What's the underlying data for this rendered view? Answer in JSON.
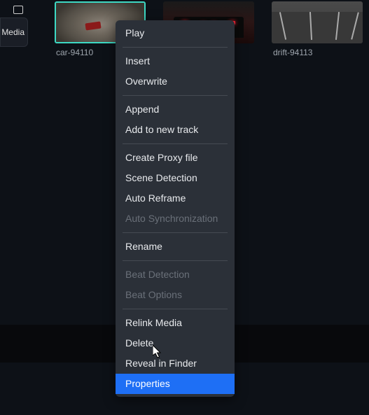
{
  "sidebar": {
    "label": "Media"
  },
  "thumbnails": [
    {
      "label": "car-94110"
    },
    {
      "label": ""
    },
    {
      "label": "drift-94113"
    }
  ],
  "context_menu": {
    "groups": [
      [
        {
          "key": "play",
          "label": "Play",
          "enabled": true,
          "highlighted": false
        }
      ],
      [
        {
          "key": "insert",
          "label": "Insert",
          "enabled": true,
          "highlighted": false
        },
        {
          "key": "overwrite",
          "label": "Overwrite",
          "enabled": true,
          "highlighted": false
        }
      ],
      [
        {
          "key": "append",
          "label": "Append",
          "enabled": true,
          "highlighted": false
        },
        {
          "key": "add-to-new-track",
          "label": "Add to new track",
          "enabled": true,
          "highlighted": false
        }
      ],
      [
        {
          "key": "create-proxy-file",
          "label": "Create Proxy file",
          "enabled": true,
          "highlighted": false
        },
        {
          "key": "scene-detection",
          "label": "Scene Detection",
          "enabled": true,
          "highlighted": false
        },
        {
          "key": "auto-reframe",
          "label": "Auto Reframe",
          "enabled": true,
          "highlighted": false
        },
        {
          "key": "auto-synchronization",
          "label": "Auto Synchronization",
          "enabled": false,
          "highlighted": false
        }
      ],
      [
        {
          "key": "rename",
          "label": "Rename",
          "enabled": true,
          "highlighted": false
        }
      ],
      [
        {
          "key": "beat-detection",
          "label": "Beat Detection",
          "enabled": false,
          "highlighted": false
        },
        {
          "key": "beat-options",
          "label": "Beat Options",
          "enabled": false,
          "highlighted": false
        }
      ],
      [
        {
          "key": "relink-media",
          "label": "Relink Media",
          "enabled": true,
          "highlighted": false
        },
        {
          "key": "delete",
          "label": "Delete",
          "enabled": true,
          "highlighted": false
        },
        {
          "key": "reveal-in-finder",
          "label": "Reveal in Finder",
          "enabled": true,
          "highlighted": false
        },
        {
          "key": "properties",
          "label": "Properties",
          "enabled": true,
          "highlighted": true
        }
      ]
    ]
  }
}
